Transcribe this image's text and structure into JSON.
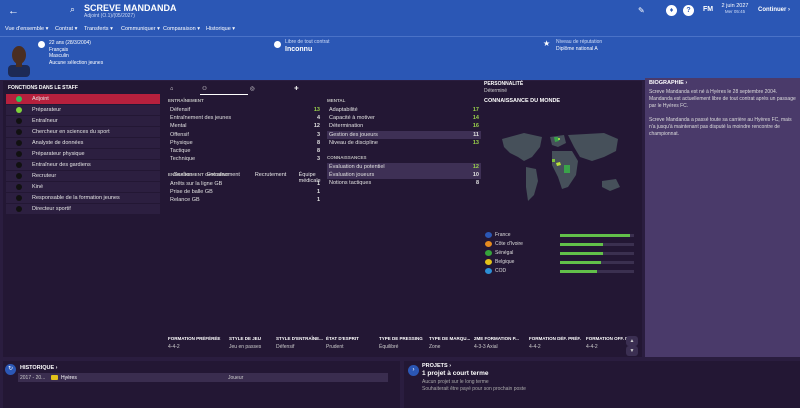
{
  "header": {
    "player_name": "SCREVE MANDANDA",
    "subtitle": "Adjoint (O.1)/(05/2027)",
    "fm_logo": "FM",
    "date_line1": "2 juin 2027",
    "date_line2": "Mer 05:45",
    "continue_label": "Continuer",
    "continue_arrow": "›",
    "menu": [
      "Vue d'ensemble ▾",
      "Contrat ▾",
      "Transferts ▾",
      "Communiquer ▾",
      "Comparaison ▾",
      "Historique ▾"
    ],
    "age": "22 ans (28/3/2004)",
    "nationality": "Français",
    "gender": "Masculin",
    "selection": "Aucune sélection jeunes",
    "contract_label": "Libre de tout contrat",
    "contract_value": "Inconnu",
    "rep_label": "Niveau de réputation",
    "rep_value": "Diplôme national A",
    "brand_color": "#2b57b5"
  },
  "staff": {
    "heading": "FONCTIONS DANS LE STAFF",
    "items": [
      {
        "label": "Adjoint",
        "color": "#2fc55a"
      },
      {
        "label": "Préparateur",
        "color": "#7fd33a"
      },
      {
        "label": "Entraîneur",
        "color": "#111111"
      },
      {
        "label": "Chercheur en sciences du sport",
        "color": "#111111"
      },
      {
        "label": "Analyste de données",
        "color": "#111111"
      },
      {
        "label": "Préparateur physique",
        "color": "#111111"
      },
      {
        "label": "Entraîneur des gardiens",
        "color": "#111111"
      },
      {
        "label": "Recruteur",
        "color": "#111111"
      },
      {
        "label": "Kiné",
        "color": "#111111"
      },
      {
        "label": "Responsable de la formation jeunes",
        "color": "#111111"
      },
      {
        "label": "Directeur sportif",
        "color": "#111111"
      }
    ]
  },
  "tabs": [
    "Gestion",
    "Entraînement",
    "Recrutement",
    "Équipe médicale"
  ],
  "entrainement": {
    "heading": "ENTRAÎNEMENT",
    "rows": [
      {
        "n": "Défensif",
        "v": "13"
      },
      {
        "n": "Entraînement des jeunes",
        "v": "4"
      },
      {
        "n": "Mental",
        "v": "12"
      },
      {
        "n": "Offensif",
        "v": "3"
      },
      {
        "n": "Physique",
        "v": "8"
      },
      {
        "n": "Tactique",
        "v": "8"
      },
      {
        "n": "Technique",
        "v": "3"
      }
    ]
  },
  "gardiens": {
    "heading": "ENTRAÎNEMENT GARDIENS",
    "rows": [
      {
        "n": "Arrêts sur la ligne GB",
        "v": "1"
      },
      {
        "n": "Prise de balle GB",
        "v": "1"
      },
      {
        "n": "Relance GB",
        "v": "1"
      }
    ]
  },
  "mental": {
    "heading": "MENTAL",
    "rows": [
      {
        "n": "Adaptabilité",
        "v": "17"
      },
      {
        "n": "Capacité à motiver",
        "v": "14"
      },
      {
        "n": "Détermination",
        "v": "16"
      },
      {
        "n": "Gestion des joueurs",
        "v": "11"
      },
      {
        "n": "Niveau de discipline",
        "v": "13"
      }
    ]
  },
  "connaissances": {
    "heading": "CONNAISSANCES",
    "rows": [
      {
        "n": "Évaluation du potentiel",
        "v": "12"
      },
      {
        "n": "Évaluation joueurs",
        "v": "10"
      },
      {
        "n": "Notions tactiques",
        "v": "8"
      }
    ]
  },
  "personality": {
    "heading": "PERSONNALITÉ",
    "value": "Déterminé"
  },
  "world": {
    "heading": "CONNAISSANCE DU MONDE",
    "nations": [
      {
        "n": "France",
        "level": 0.95,
        "flag": "#2b57b5"
      },
      {
        "n": "Côte d'Ivoire",
        "level": 0.58,
        "flag": "#e58a1f"
      },
      {
        "n": "Sénégal",
        "level": 0.58,
        "flag": "#36a33b"
      },
      {
        "n": "Belgique",
        "level": 0.55,
        "flag": "#e3c21a"
      },
      {
        "n": "COD",
        "level": 0.5,
        "flag": "#2c8fd6"
      }
    ]
  },
  "tactics": [
    {
      "h": "FORMATION PRÉFÉRÉE",
      "v": "4-4-2"
    },
    {
      "h": "STYLE DE JEU",
      "v": "Jeu en passes"
    },
    {
      "h": "STYLE D'ENTRAÎNE...",
      "v": "Défensif"
    },
    {
      "h": "ÉTAT D'ESPRIT",
      "v": "Prudent"
    },
    {
      "h": "TYPE DE PRESSING",
      "v": "Équilibré"
    },
    {
      "h": "TYPE DE MARQU...",
      "v": "Zone"
    },
    {
      "h": "2ME FORMATION P...",
      "v": "4-3-3 Axial"
    },
    {
      "h": "FORMATION DÉF. PRÉF.",
      "v": "4-4-2"
    },
    {
      "h": "FORMATION OFF. P...",
      "v": "4-4-2"
    }
  ],
  "bio": {
    "heading": "BIOGRAPHIE ›",
    "p1": "Screve Mandanda est né à Hyères le 28 septembre 2004. Mandanda est actuellement libre de tout contrat après un passage par le Hyères FC.",
    "p2": "Screve Mandanda a passé toute sa carrière au Hyères FC, mais n'a jusqu'à maintenant pas disputé la moindre rencontre de championnat."
  },
  "history": {
    "heading": "HISTORIQUE ›",
    "period": "2017 - 20...",
    "club": "Hyères",
    "role": "Joueur"
  },
  "projects": {
    "heading": "PROJETS ›",
    "title": "1 projet à court terme",
    "l1": "Aucun projet sur le long terme",
    "l2": "Souhaiterait être payé pour son prochain poste"
  }
}
